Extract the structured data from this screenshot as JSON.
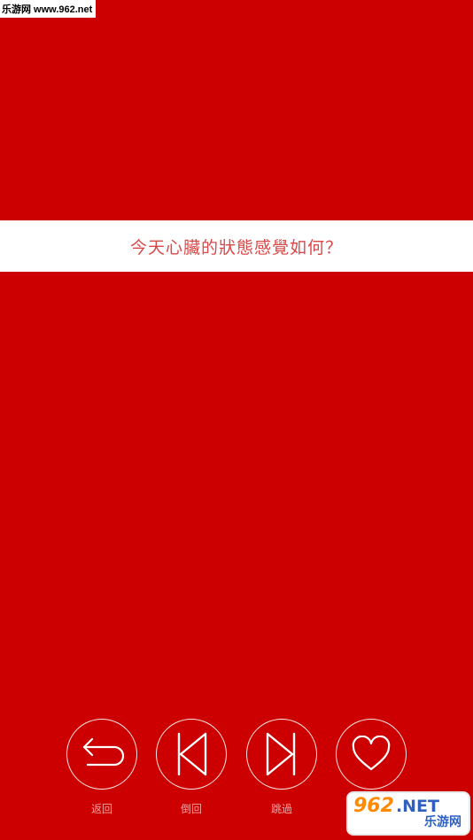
{
  "watermark": {
    "top_text": "乐游网 www.962.net",
    "badge_number": "962",
    "badge_domain": ".NET",
    "badge_name": "乐游网"
  },
  "question": {
    "text": "今天心臟的狀態感覺如何？"
  },
  "controls": [
    {
      "label": "返回",
      "icon": "undo-arrow-icon"
    },
    {
      "label": "倒回",
      "icon": "skip-back-icon"
    },
    {
      "label": "跳過",
      "icon": "skip-forward-icon"
    },
    {
      "label": "",
      "icon": "heart-icon"
    }
  ],
  "colors": {
    "background": "#cc0000",
    "band": "#ffffff",
    "question_text": "#d94848",
    "control_stroke": "#ffffff",
    "label_text": "#f3a3a3"
  }
}
